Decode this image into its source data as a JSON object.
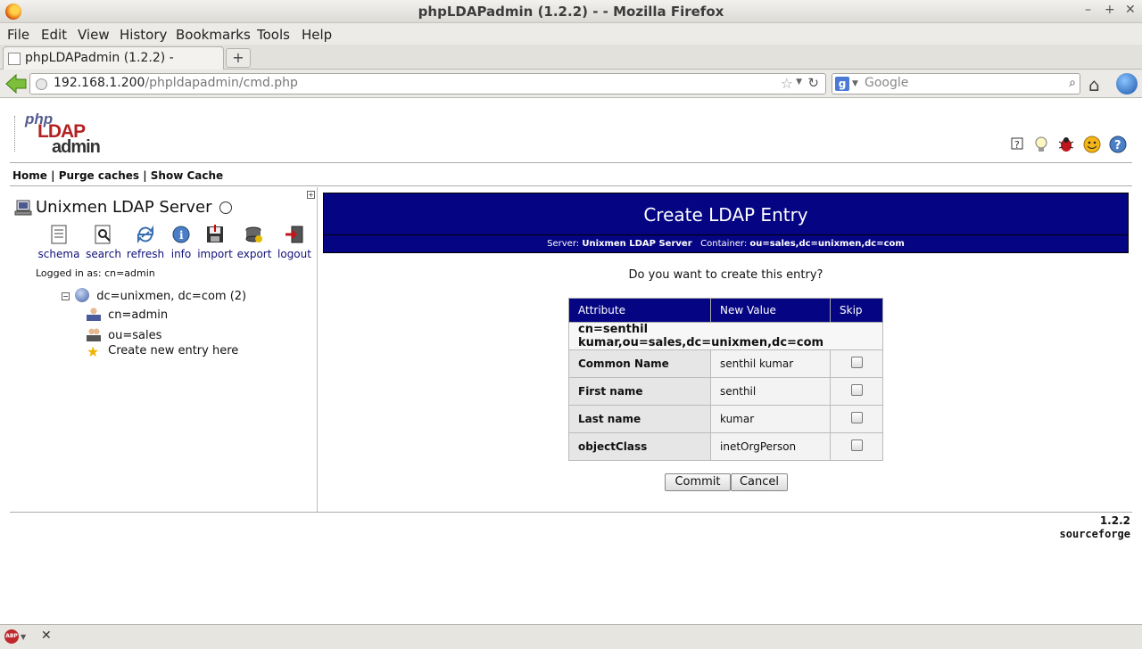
{
  "window": {
    "title": "phpLDAPadmin (1.2.2) - - Mozilla Firefox",
    "minimize": "–",
    "maximize": "+",
    "close": "✕"
  },
  "menu": [
    "File",
    "Edit",
    "View",
    "History",
    "Bookmarks",
    "Tools",
    "Help"
  ],
  "tab": {
    "label": "phpLDAPadmin (1.2.2) -",
    "new_tab": "+"
  },
  "nav": {
    "url_host": "192.168.1.200",
    "url_path": "/phpldapadmin/cmd.php",
    "search_placeholder": "Google"
  },
  "top_menu": {
    "home": "Home",
    "purge": "Purge caches",
    "show_cache": "Show Cache",
    "sep": "|"
  },
  "server": {
    "name": "Unixmen LDAP Server",
    "tools": [
      "schema",
      "search",
      "refresh",
      "info",
      "import",
      "export",
      "logout"
    ],
    "logged_in": "Logged in as: cn=admin"
  },
  "tree": {
    "root": "dc=unixmen, dc=com (2)",
    "children": [
      "cn=admin",
      "ou=sales"
    ],
    "create": "Create new entry here"
  },
  "panel": {
    "title": "Create LDAP Entry",
    "server_label": "Server:",
    "server_value": "Unixmen LDAP Server",
    "container_label": "Container:",
    "container_value": "ou=sales,dc=unixmen,dc=com",
    "question": "Do you want to create this entry?"
  },
  "table": {
    "headers": [
      "Attribute",
      "New Value",
      "Skip"
    ],
    "dn": "cn=senthil kumar,ou=sales,dc=unixmen,dc=com",
    "rows": [
      {
        "attr": "Common Name",
        "value": "senthil kumar"
      },
      {
        "attr": "First name",
        "value": "senthil"
      },
      {
        "attr": "Last name",
        "value": "kumar"
      },
      {
        "attr": "objectClass",
        "value": "inetOrgPerson"
      }
    ]
  },
  "buttons": {
    "commit": "Commit",
    "cancel": "Cancel"
  },
  "footer": {
    "version": "1.2.2",
    "sourceforge": "sourceforge"
  },
  "addon": {
    "abp": "ABP",
    "close": "✕"
  },
  "colors": {
    "header_blue": "#050584",
    "link_blue": "#11117a",
    "logo_red": "#b22222"
  }
}
